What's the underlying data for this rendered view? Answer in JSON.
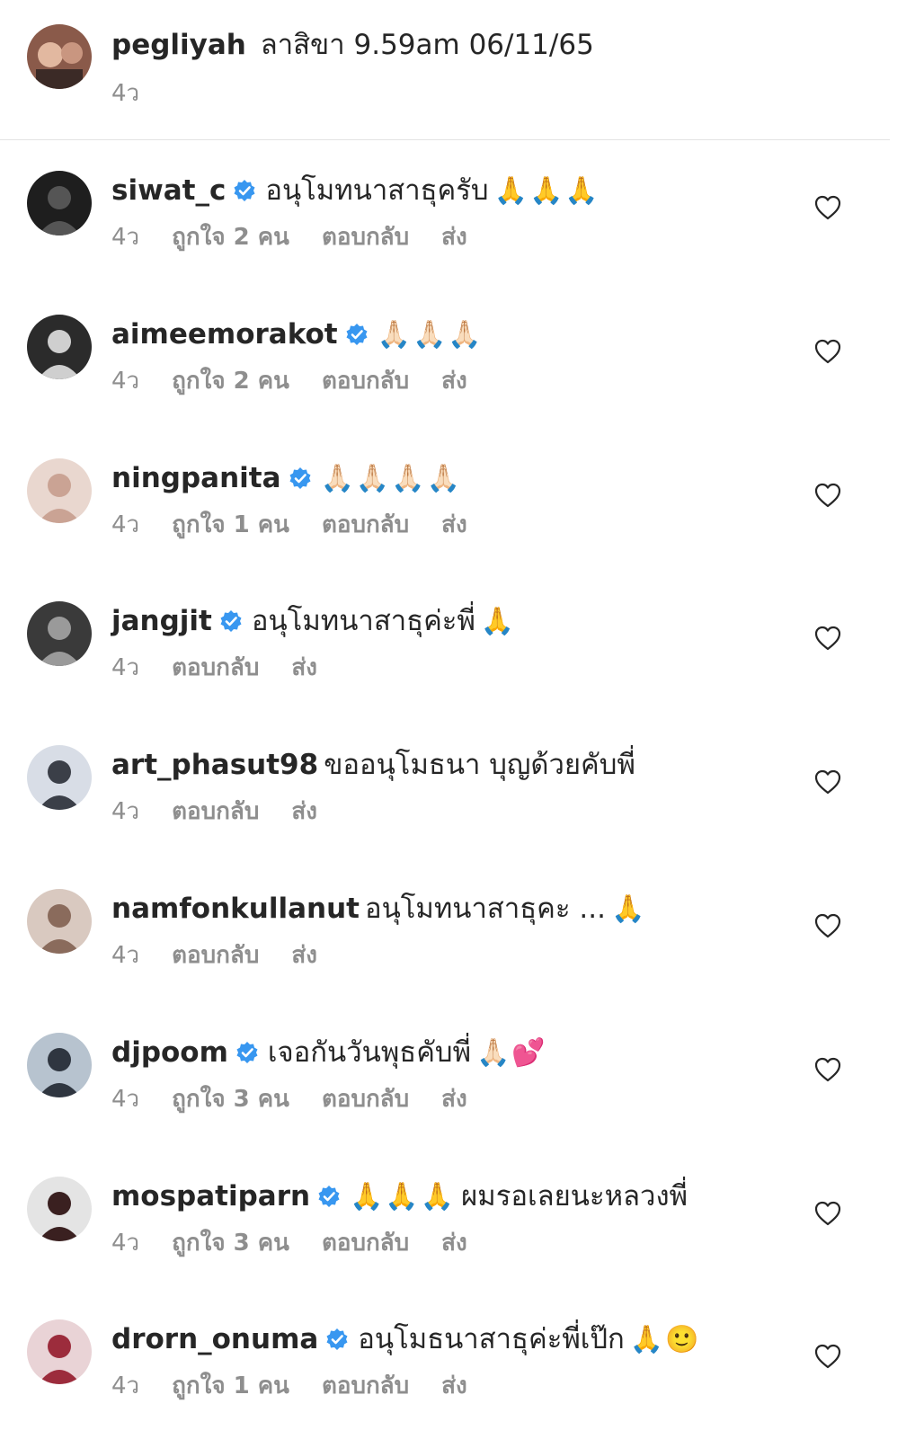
{
  "caption": {
    "username": "pegliyah",
    "text": "ลาสิขา 9.59am 06/11/65",
    "age": "4ว"
  },
  "labels": {
    "reply": "ตอบกลับ",
    "send": "ส่ง"
  },
  "comments": [
    {
      "username": "siwat_c",
      "verified": true,
      "text": "อนุโมทนาสาธุครับ",
      "emoji": "🙏🙏🙏",
      "age": "4ว",
      "likes": "ถูกใจ 2 คน"
    },
    {
      "username": "aimeemorakot",
      "verified": true,
      "text": "",
      "emoji": "🙏🏻🙏🏻🙏🏻",
      "age": "4ว",
      "likes": "ถูกใจ 2 คน"
    },
    {
      "username": "ningpanita",
      "verified": true,
      "text": "",
      "emoji": "🙏🏻🙏🏻🙏🏻🙏🏻",
      "age": "4ว",
      "likes": "ถูกใจ 1 คน"
    },
    {
      "username": "jangjit",
      "verified": true,
      "text": "อนุโมทนาสาธุค่ะพี่",
      "emoji": "🙏",
      "age": "4ว",
      "likes": ""
    },
    {
      "username": "art_phasut98",
      "verified": false,
      "text": "ขออนุโมธนา บุญด้วยคับพี่",
      "emoji": "",
      "age": "4ว",
      "likes": ""
    },
    {
      "username": "namfonkullanut",
      "verified": false,
      "text": "อนุโมทนาสาธุคะ ...",
      "emoji": "🙏",
      "age": "4ว",
      "likes": ""
    },
    {
      "username": "djpoom",
      "verified": true,
      "text": "เจอกันวันพุธคับพี่",
      "emoji": "🙏🏻💕",
      "age": "4ว",
      "likes": "ถูกใจ 3 คน"
    },
    {
      "username": "mospatiparn",
      "verified": true,
      "text": "ผมรอเลยนะหลวงพี่",
      "emoji": "🙏🙏🙏",
      "emoji_first": true,
      "age": "4ว",
      "likes": "ถูกใจ 3 คน"
    },
    {
      "username": "drorn_onuma",
      "verified": true,
      "text": "อนุโมธนาสาธุค่ะพี่เป๊ก",
      "emoji": "🙏🙂",
      "age": "4ว",
      "likes": "ถูกใจ 1 คน"
    }
  ],
  "colors": {
    "text": "#262626",
    "meta": "#8e8e8e",
    "verified": "#3897f0",
    "divider": "#e3e3e3"
  },
  "icons": {
    "verified": "verified-badge-icon",
    "like": "heart-outline-icon"
  }
}
